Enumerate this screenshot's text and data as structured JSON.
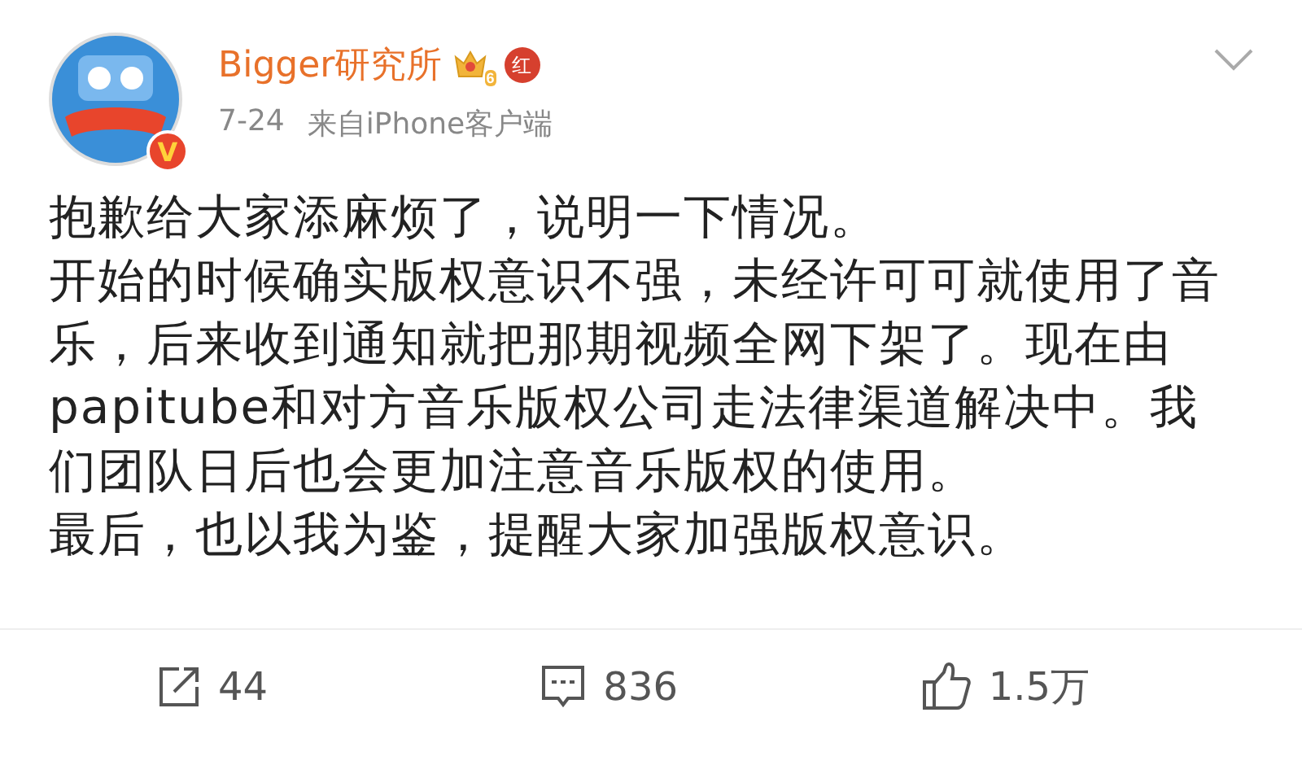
{
  "post": {
    "author": "Bigger研究所",
    "verified_mark": "V",
    "badges": [
      {
        "kind": "crown",
        "text": "6"
      },
      {
        "kind": "red",
        "text": "红"
      }
    ],
    "time": "7-24",
    "source": "来自iPhone客户端",
    "paragraphs": [
      "抱歉给大家添麻烦了，说明一下情况。",
      "开始的时候确实版权意识不强，未经许可可就使用了音乐，后来收到通知就把那期视频全网下架了。现在由papitube和对方音乐版权公司走法律渠道解决中。我们团队日后也会更加注意音乐版权的使用。",
      "最后，也以我为鉴，提醒大家加强版权意识。"
    ]
  },
  "actions": [
    {
      "kind": "repost",
      "count": "44"
    },
    {
      "kind": "comment",
      "count": "836"
    },
    {
      "kind": "like",
      "count": "1.5万"
    }
  ]
}
